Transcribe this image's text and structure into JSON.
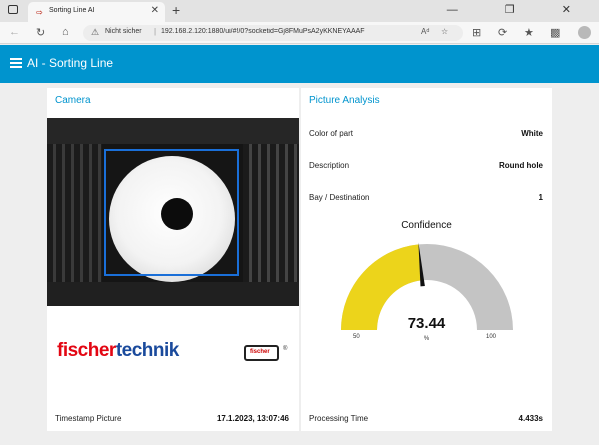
{
  "browser": {
    "tab_title": "Sorting Line AI",
    "tab_close": "✕",
    "new_tab": "+",
    "window_controls": "— ❐ ✕",
    "security_label": "Nicht sicher",
    "url": "192.168.2.120:1880/ui/#!/0?socketid=Gj8FMuPsA2yKKNEYAAAF"
  },
  "app": {
    "title": "AI - Sorting Line"
  },
  "camera_card": {
    "title": "Camera",
    "logo_part1": "fischer",
    "logo_part2": "technik",
    "badge_text": "fischer",
    "reg_mark": "®",
    "timestamp_label": "Timestamp Picture",
    "timestamp_value": "17.1.2023, 13:07:46"
  },
  "analysis_card": {
    "title": "Picture Analysis",
    "rows": [
      {
        "label": "Color of part",
        "value": "White"
      },
      {
        "label": "Description",
        "value": "Round hole"
      },
      {
        "label": "Bay / Destination",
        "value": "1"
      }
    ],
    "gauge": {
      "title": "Confidence",
      "value": 73.44,
      "value_text": "73.44",
      "unit": "%",
      "min": 50,
      "max": 100,
      "min_text": "50",
      "max_text": "100",
      "fill_color": "#ecd41b",
      "track_color": "#c4c4c4"
    },
    "processing_label": "Processing Time",
    "processing_value": "4.433s"
  },
  "colors": {
    "accent": "#0094ce",
    "page_bg": "#eeeeee"
  }
}
